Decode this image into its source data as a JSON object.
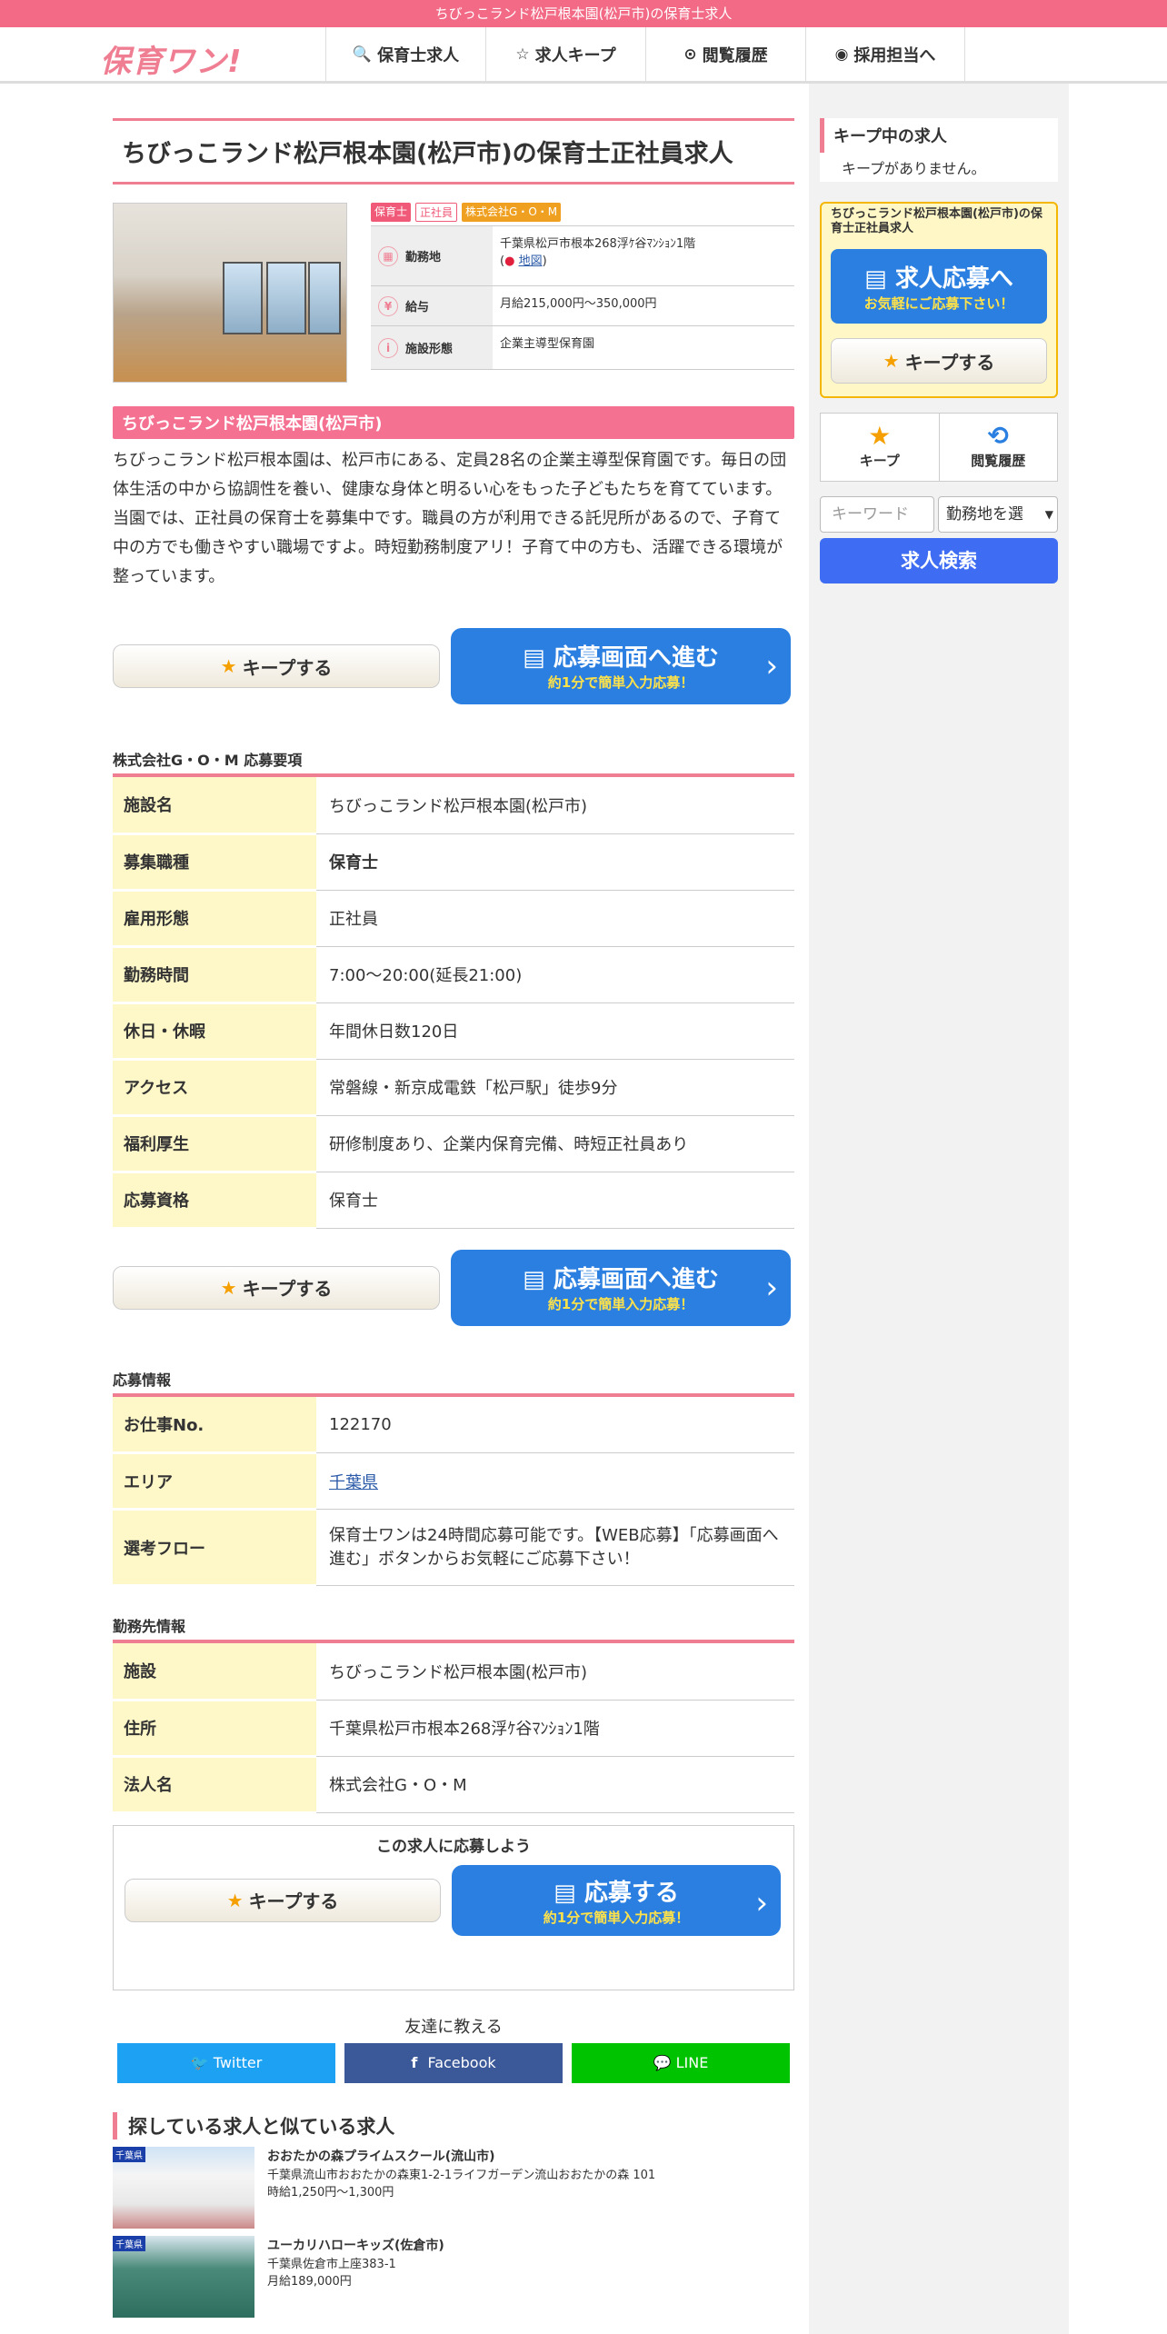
{
  "topbar": "ちびっこランド松戸根本園(松戸市)の保育士求人",
  "logo": "保育ワン!",
  "nav": [
    {
      "icon": "search-icon",
      "label": "保育士求人"
    },
    {
      "icon": "star-icon",
      "label": "求人キープ"
    },
    {
      "icon": "clock-icon",
      "label": "閲覧履歴"
    },
    {
      "icon": "user-icon",
      "label": "採用担当へ"
    }
  ],
  "main": {
    "title": "ちびっこランド松戸根本園(松戸市)の保育士正社員求人",
    "tags": [
      "保育士",
      "正社員",
      "株式会社G・O・M"
    ],
    "info": [
      {
        "icon": "building-icon",
        "label": "勤務地",
        "value": "千葉県松戸市根本268浮ｹ谷ﾏﾝｼｮﾝ1階",
        "link": "地図"
      },
      {
        "icon": "yen-icon",
        "label": "給与",
        "value": "月給215,000円～350,000円"
      },
      {
        "icon": "info-icon",
        "label": "施設形態",
        "value": "企業主導型保育園"
      }
    ],
    "section_title": "ちびっこランド松戸根本園(松戸市)",
    "description": "ちびっこランド松戸根本園は、松戸市にある、定員28名の企業主導型保育園です。毎日の団体生活の中から協調性を養い、健康な身体と明るい心をもった子どもたちを育てています。当園では、正社員の保育士を募集中です。職員の方が利用できる託児所があるので、子育て中の方でも働きやすい職場ですよ。時短勤務制度アリ！子育て中の方も、活躍できる環境が整っています。",
    "keep_label": "キープする",
    "apply_big": "応募画面へ進む",
    "apply_small": "約1分で簡単入力応募！",
    "req_title": "株式会社G・O・M 応募要項",
    "requirements": [
      {
        "k": "施設名",
        "v": "ちびっこランド松戸根本園(松戸市)"
      },
      {
        "k": "募集職種",
        "v": "保育士"
      },
      {
        "k": "雇用形態",
        "v": "正社員"
      },
      {
        "k": "勤務時間",
        "v": "7:00～20:00(延長21:00)"
      },
      {
        "k": "休日・休暇",
        "v": "年間休日数120日"
      },
      {
        "k": "アクセス",
        "v": "常磐線・新京成電鉄「松戸駅」徒歩9分"
      },
      {
        "k": "福利厚生",
        "v": "研修制度あり、企業内保育完備、時短正社員あり"
      },
      {
        "k": "応募資格",
        "v": "保育士"
      }
    ],
    "apply_info_title": "応募情報",
    "apply_info": [
      {
        "k": "お仕事No.",
        "v": "122170"
      },
      {
        "k": "エリア",
        "v": "千葉県"
      },
      {
        "k": "選考フロー",
        "v": "保育士ワンは24時間応募可能です。【WEB応募】「応募画面へ進む」ボタンからお気軽にご応募下さい！"
      }
    ],
    "work_title": "勤務先情報",
    "work_info": [
      {
        "k": "施設",
        "v": "ちびっこランド松戸根本園(松戸市)"
      },
      {
        "k": "住所",
        "v": "千葉県松戸市根本268浮ｹ谷ﾏﾝｼｮﾝ1階"
      },
      {
        "k": "法人名",
        "v": "株式会社G・O・M"
      }
    ],
    "applybox_caption": "この求人に応募しよう",
    "applybox_big": "応募する",
    "share_caption": "友達に教える",
    "share": [
      {
        "label": "Twitter",
        "icon": "twitter-icon",
        "color": "#1da1f2"
      },
      {
        "label": "Facebook",
        "icon": "facebook-icon",
        "color": "#3b5998"
      },
      {
        "label": "LINE",
        "icon": "line-icon",
        "color": "#00c300"
      }
    ],
    "similar_title": "探している求人と似ている求人",
    "similar": [
      {
        "badge": "千葉県",
        "name": "おおたかの森プライムスクール(流山市)",
        "addr": "千葉県流山市おおたかの森東1-2-1ライフガーデン流山おおたかの森 101",
        "pay": "時給1,250円～1,300円"
      },
      {
        "badge": "千葉県",
        "name": "ユーカリハローキッズ(佐倉市)",
        "addr": "千葉県佐倉市上座383-1",
        "pay": "月給189,000円"
      }
    ]
  },
  "sidebar": {
    "keep_title": "キープ中の求人",
    "keep_empty": "キープがありません。",
    "job_title": "ちびっこランド松戸根本園(松戸市)の保育士正社員求人",
    "apply_big": "求人応募へ",
    "apply_small": "お気軽にご応募下さい！",
    "keep_label": "キープする",
    "keep_icon_label": "キープ",
    "history_label": "閲覧履歴",
    "keyword_placeholder": "キーワード",
    "area_select": "勤務地を選",
    "search_label": "求人検索"
  }
}
